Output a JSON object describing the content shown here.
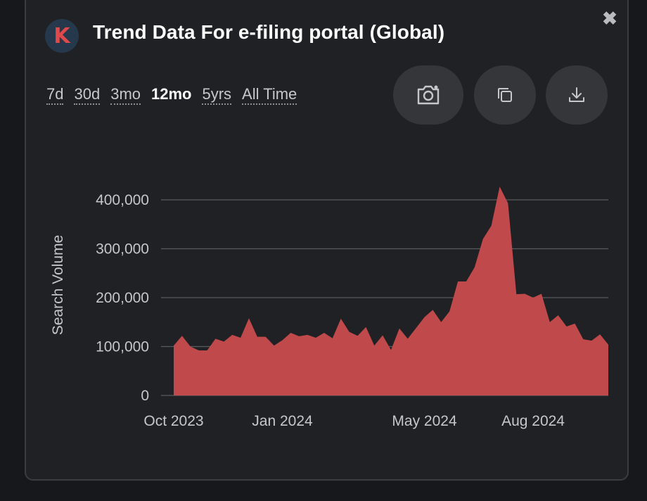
{
  "header": {
    "logo_letter": "K",
    "title": "Trend Data For e-filing portal (Global)",
    "close_icon": "close-icon"
  },
  "time_ranges": [
    {
      "label": "7d",
      "active": false
    },
    {
      "label": "30d",
      "active": false
    },
    {
      "label": "3mo",
      "active": false
    },
    {
      "label": "12mo",
      "active": true
    },
    {
      "label": "5yrs",
      "active": false
    },
    {
      "label": "All Time",
      "active": false
    }
  ],
  "actions": {
    "screenshot_icon": "camera-icon",
    "copy_icon": "copy-icon",
    "download_icon": "download-icon"
  },
  "colors": {
    "area_fill": "#c0494b",
    "background": "#202124",
    "grid": "#5a5b5f",
    "text": "#c6c7ca"
  },
  "chart_data": {
    "type": "area",
    "ylabel": "Search Volume",
    "ylim": [
      0,
      400000
    ],
    "yticks": [
      {
        "value": 0,
        "label": "0"
      },
      {
        "value": 100000,
        "label": "100,000"
      },
      {
        "value": 200000,
        "label": "200,000"
      },
      {
        "value": 300000,
        "label": "300,000"
      },
      {
        "value": 400000,
        "label": "400,000"
      }
    ],
    "x_tick_labels": [
      {
        "label": "Oct 2023",
        "index": 0
      },
      {
        "label": "Jan 2024",
        "index": 13
      },
      {
        "label": "May 2024",
        "index": 30
      },
      {
        "label": "Aug 2024",
        "index": 43
      }
    ],
    "series": [
      {
        "values": [
          102000,
          122000,
          100000,
          92000,
          92000,
          116000,
          110000,
          124000,
          118000,
          158000,
          120000,
          120000,
          102000,
          113000,
          128000,
          121000,
          124000,
          118000,
          128000,
          117000,
          157000,
          130000,
          122000,
          140000,
          102000,
          123000,
          93000,
          137000,
          116000,
          138000,
          160000,
          175000,
          150000,
          172000,
          233000,
          233000,
          262000,
          320000,
          347000,
          427000,
          393000,
          207000,
          208000,
          200000,
          208000,
          150000,
          164000,
          141000,
          147000,
          115000,
          112000,
          125000,
          104000
        ]
      }
    ]
  }
}
